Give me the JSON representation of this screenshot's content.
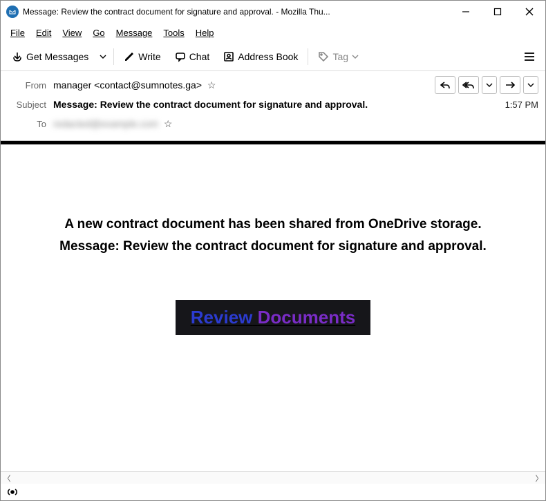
{
  "window": {
    "title": "Message: Review the contract document for signature and approval. - Mozilla Thu..."
  },
  "menu": {
    "file": "File",
    "edit": "Edit",
    "view": "View",
    "go": "Go",
    "message": "Message",
    "tools": "Tools",
    "help": "Help"
  },
  "toolbar": {
    "get_messages": "Get Messages",
    "write": "Write",
    "chat": "Chat",
    "address_book": "Address Book",
    "tag": "Tag"
  },
  "headers": {
    "from_label": "From",
    "from_value": "manager <contact@sumnotes.ga>",
    "subject_label": "Subject",
    "subject_value": "Message: Review the contract document for signature and approval.",
    "to_label": "To",
    "to_value": "redacted@example.com",
    "time": "1:57 PM"
  },
  "body": {
    "line1": "A new contract document has been shared from OneDrive storage.",
    "line2": "Message: Review the contract document for signature and approval.",
    "review_word1": "Review",
    "review_word2": "Documents"
  },
  "icons": {
    "app": "✉",
    "star": "☆"
  }
}
